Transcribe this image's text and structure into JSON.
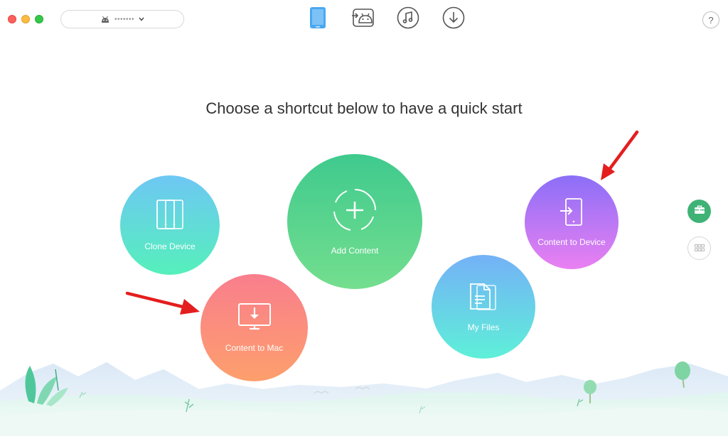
{
  "window": {
    "device_selector": {
      "device_name": "•••••••",
      "icon": "android-icon",
      "chevron": "chevron-down-icon"
    },
    "toolbar": [
      {
        "id": "device-manager",
        "icon": "phone-icon",
        "active": true,
        "color": "#4aa8f0"
      },
      {
        "id": "android-mover",
        "icon": "android-transfer-icon",
        "active": false,
        "color": "#555555"
      },
      {
        "id": "audio-manager",
        "icon": "music-note-icon",
        "active": false,
        "color": "#555555"
      },
      {
        "id": "downloader",
        "icon": "download-icon",
        "active": false,
        "color": "#555555"
      }
    ],
    "help_label": "?"
  },
  "heading": "Choose a shortcut below to have a quick start",
  "shortcuts": {
    "clone_device": {
      "label": "Clone Device",
      "icon": "clone-phones-icon"
    },
    "add_content": {
      "label": "Add Content",
      "icon": "plus-circle-icon"
    },
    "content_to_device": {
      "label": "Content to Device",
      "icon": "phone-import-icon"
    },
    "my_files": {
      "label": "My Files",
      "icon": "documents-icon"
    },
    "content_to_mac": {
      "label": "Content to Mac",
      "icon": "monitor-download-icon"
    }
  },
  "side_controls": [
    {
      "id": "toolbox",
      "icon": "toolbox-icon",
      "active": true,
      "color": "#3fb276"
    },
    {
      "id": "grid-view",
      "icon": "grid-icon",
      "active": false
    }
  ],
  "annotations": {
    "arrow_color": "#e41e1e"
  }
}
